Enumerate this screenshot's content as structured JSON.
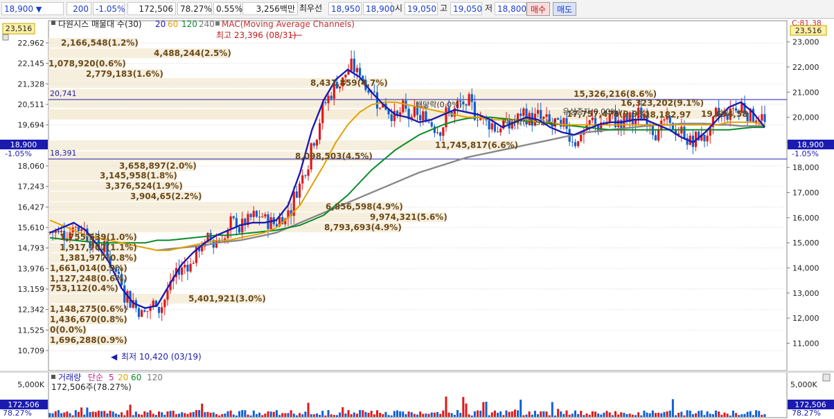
{
  "toolbar": {
    "price": "18,900",
    "change": "200",
    "change_pct": "-1.05%",
    "volume": "172,506",
    "volume_ratio": "78.27%",
    "turnover": "0.55%",
    "amount": "3,256백만",
    "best_label": "최우선",
    "ask": "18,950",
    "bid": "18,900",
    "open_label": "시",
    "open": "19,050",
    "high_label": "고",
    "high": "19,050",
    "low_label": "저",
    "low": "18,800",
    "buy_label": "매수",
    "sell_label": "매도"
  },
  "price_panel": {
    "indicator_label": "다원시스 매물대 수(30)",
    "ma_periods": [
      "20",
      "60",
      "120",
      "240"
    ],
    "mac_label": "MAC(Moving Average Channels)",
    "top_left_value": "23,516",
    "top_right_value": "23,516",
    "right_corner_label": "C:81.38",
    "high_annotation": "최고 23,396 (08/31)",
    "low_annotation": "최저 10,420 (03/19)",
    "left_ticks": [
      "22,962",
      "22,145",
      "21,328",
      "20,511",
      "19,694",
      "18,060",
      "17,243",
      "16,427",
      "15,610",
      "14,793",
      "13,976",
      "13,159",
      "12,342",
      "11,525",
      "10,709"
    ],
    "right_ticks": [
      "23,000",
      "22,000",
      "21,000",
      "20,000",
      "19,000",
      "18,000",
      "17,000",
      "16,000",
      "15,000",
      "14,000",
      "13,000",
      "12,000",
      "11,000"
    ],
    "hline_upper": "20,741",
    "hline_lower": "18,391",
    "current_left": "18,900",
    "current_left_pct": "-1.05%",
    "current_right": "18,900",
    "current_right_pct": "-1.05%",
    "volume_profile": [
      "2,166,548(1.2%)",
      "4,488,244(2.5%)",
      "1,078,920(0.6%)",
      "2,779,183(1.6%)",
      "8,431,859(4,7%)",
      "15,326,216(8.6%)",
      "16,323,202(9.1%)",
      "17,757,474(9.9%)",
      "18,182,97",
      "19,694,58",
      "11,745,817(6.6%)",
      "8,098,503(4.5%)",
      "3,658,897(2.0%)",
      "3,145,958(1.8%)",
      "3,376,524(1.9%)",
      "3,904,65(2.2%)",
      "6,856,598(4.9%)",
      "9,974,321(5.6%)",
      "8,793,693(4.9%)",
      "1,755,539(1.0%)",
      "1,917,707(1.1%)",
      "1,381,977(0.8%)",
      "1,661,014(0.9%)",
      "1,127,248(0.6%)",
      "753,112(0.4%)",
      "5,401,921(3.0%)",
      "1,148,275(0.6%)",
      "1,436,670(0.8%)",
      "0(0.0%)",
      "1,696,288(0.9%)"
    ],
    "events": [
      "배당락(0.0%)",
      "유상증자(0.00%)",
      "권리락(-3.52%)"
    ]
  },
  "volume_panel": {
    "label": "거래량",
    "ma_label": "단순",
    "ma_periods": [
      "5",
      "20",
      "60",
      "120"
    ],
    "current_text": "172,506주(78.27%)",
    "tick": "5,000K",
    "current_left": "172,506",
    "current_left_pct": "78.27%",
    "current_right": "172,506",
    "current_right_pct": "78.27%"
  },
  "chart_data": {
    "type": "candlestick",
    "ylim": [
      10420,
      23516
    ],
    "series": [
      {
        "name": "20",
        "values": [
          15400,
          15600,
          15800,
          15500,
          14900,
          14200,
          13200,
          12600,
          12400,
          12500,
          13300,
          14100,
          14600,
          15000,
          15300,
          15500,
          15700,
          15800,
          15800,
          15900,
          16500,
          17800,
          19500,
          20700,
          21500,
          21900,
          21600,
          21000,
          20500,
          20100,
          20000,
          19800,
          19900,
          20100,
          20300,
          20200,
          20100,
          19900,
          19600,
          19800,
          20000,
          19900,
          19600,
          19400,
          19300,
          19500,
          19700,
          19800,
          19800,
          19900,
          19900,
          19700,
          19500,
          19200,
          19000,
          19400,
          19900,
          20400,
          20600,
          20200,
          19600
        ]
      },
      {
        "name": "60",
        "values": [
          15900,
          15700,
          15500,
          15300,
          15200,
          15100,
          15000,
          14900,
          14800,
          14700,
          14700,
          14800,
          14900,
          15000,
          15100,
          15100,
          15200,
          15300,
          15400,
          15600,
          16000,
          16500,
          17300,
          18100,
          19000,
          19700,
          20200,
          20500,
          20600,
          20600,
          20500,
          20400,
          20300,
          20200,
          20100,
          20000,
          20000,
          19900,
          19900,
          19900,
          19900,
          19800,
          19800,
          19700,
          19700,
          19700,
          19700,
          19700,
          19700,
          19700,
          19700,
          19700,
          19700,
          19700,
          19700,
          19700,
          19700,
          19800,
          19800,
          19800,
          19700
        ]
      },
      {
        "name": "120",
        "values": [
          15200,
          15150,
          15100,
          15050,
          15000,
          15000,
          15000,
          15000,
          15000,
          15100,
          15100,
          15150,
          15200,
          15250,
          15300,
          15300,
          15350,
          15400,
          15450,
          15500,
          15600,
          15700,
          15900,
          16100,
          16500,
          16900,
          17400,
          17900,
          18300,
          18700,
          19000,
          19300,
          19500,
          19700,
          19850,
          19950,
          20000,
          20000,
          19950,
          19900,
          19850,
          19800,
          19750,
          19700,
          19650,
          19600,
          19550,
          19500,
          19500,
          19500,
          19500,
          19500,
          19500,
          19500,
          19500,
          19500,
          19500,
          19500,
          19550,
          19600,
          19600
        ]
      },
      {
        "name": "240",
        "values": [
          null,
          null,
          null,
          null,
          null,
          null,
          null,
          null,
          null,
          14700,
          14750,
          14800,
          14850,
          14900,
          15000,
          15050,
          15100,
          15200,
          15300,
          15400,
          15600,
          15800,
          16000,
          16200,
          16400,
          16600,
          16800,
          17000,
          17200,
          17400,
          17600,
          17800,
          17950,
          18100,
          18250,
          18400,
          18500,
          18600,
          18700,
          18800,
          18900,
          19000,
          19100,
          19200,
          19300,
          19400,
          19450,
          19500,
          19550,
          19600,
          19650,
          19700,
          19700,
          19750,
          19750,
          19750,
          19700,
          19700,
          19650,
          19650,
          19650
        ]
      }
    ],
    "volume_max": "5,000K"
  }
}
